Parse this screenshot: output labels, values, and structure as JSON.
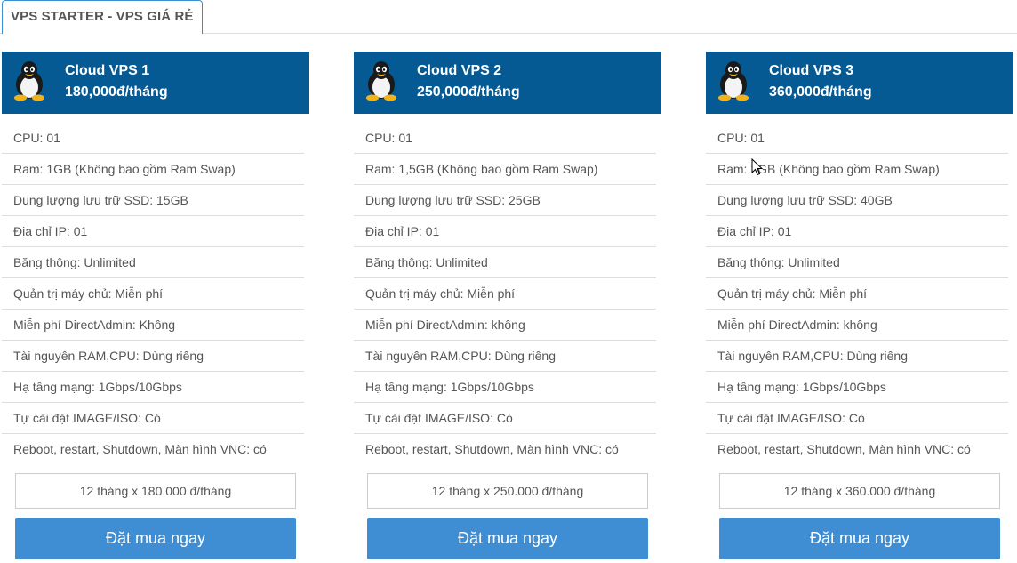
{
  "tab": {
    "label": "VPS STARTER - VPS GIÁ RẺ"
  },
  "plans": [
    {
      "name": "Cloud VPS 1",
      "price": "180,000đ/tháng",
      "features": [
        "CPU: 01",
        "Ram: 1GB (Không bao gồm Ram Swap)",
        "Dung lượng lưu trữ SSD: 15GB",
        "Địa chỉ IP: 01",
        "Băng thông: Unlimited",
        "Quản trị máy chủ: Miễn phí",
        "Miễn phí DirectAdmin: Không",
        "Tài nguyên RAM,CPU: Dùng riêng",
        "Hạ tầng mạng: 1Gbps/10Gbps",
        "Tự cài đặt IMAGE/ISO: Có",
        "Reboot, restart, Shutdown, Màn hình VNC: có"
      ],
      "term": "12 tháng x 180.000 đ/tháng",
      "button": "Đặt mua ngay"
    },
    {
      "name": "Cloud VPS 2",
      "price": "250,000đ/tháng",
      "features": [
        "CPU: 01",
        "Ram: 1,5GB (Không bao gồm Ram Swap)",
        "Dung lượng lưu trữ SSD: 25GB",
        "Địa chỉ IP: 01",
        "Băng thông: Unlimited",
        "Quản trị máy chủ: Miễn phí",
        "Miễn phí DirectAdmin: không",
        "Tài nguyên RAM,CPU: Dùng riêng",
        "Hạ tầng mạng: 1Gbps/10Gbps",
        "Tự cài đặt IMAGE/ISO: Có",
        "Reboot, restart, Shutdown, Màn hình VNC: có"
      ],
      "term": "12 tháng x 250.000 đ/tháng",
      "button": "Đặt mua ngay"
    },
    {
      "name": "Cloud VPS 3",
      "price": "360,000đ/tháng",
      "features": [
        "CPU: 01",
        "Ram: 2GB (Không bao gồm Ram Swap)",
        "Dung lượng lưu trữ SSD: 40GB",
        "Địa chỉ IP: 01",
        "Băng thông: Unlimited",
        "Quản trị máy chủ: Miễn phí",
        "Miễn phí DirectAdmin: không",
        "Tài nguyên RAM,CPU: Dùng riêng",
        "Hạ tầng mạng: 1Gbps/10Gbps",
        "Tự cài đặt IMAGE/ISO: Có",
        "Reboot, restart, Shutdown, Màn hình VNC: có"
      ],
      "term": "12 tháng x 360.000 đ/tháng",
      "button": "Đặt mua ngay"
    }
  ],
  "icons": {
    "plan_logo": "linux-tux-icon",
    "cursor": "mouse-pointer-icon"
  },
  "colors": {
    "header_bg": "#055a94",
    "button_bg": "#3f8ed3",
    "tab_border": "#3a8fd3"
  }
}
